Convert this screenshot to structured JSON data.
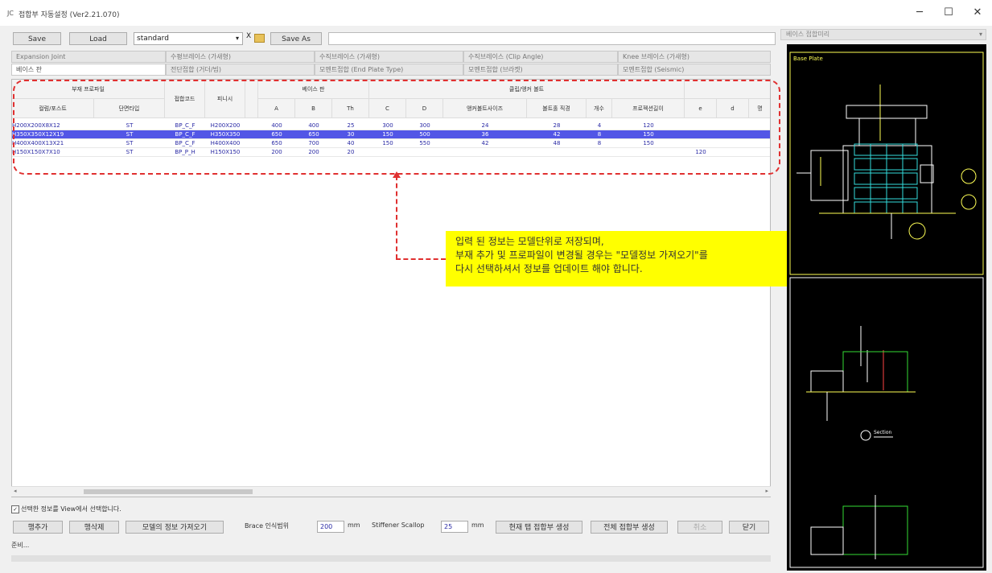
{
  "window": {
    "title": "접합부 자동설정 (Ver2.21.070)",
    "app_icon": "JC",
    "minimize": "─",
    "maximize": "☐",
    "close": "✕"
  },
  "toolbar": {
    "save": "Save",
    "load": "Load",
    "preset": "standard",
    "preset_arrow": "▾",
    "clear": "X",
    "save_as": "Save As",
    "path": ""
  },
  "tabs": [
    "Expansion Joint",
    "수평브레이스 (가새형)",
    "수직브레이스 (가새형)",
    "수직브레이스 (Clip Angle)",
    "Knee 브레이스 (가새형)",
    "베이스 판",
    "전단접합 (거더/빔)",
    "모멘트접합 (End Plate Type)",
    "모멘트접합 (브라켓)",
    "모멘트접합 (Seismic)"
  ],
  "grid": {
    "group_headers": [
      "부재 프로파일",
      "베이스 판",
      "클립/앵커 볼트"
    ],
    "headers": [
      "컬럼/포스트",
      "단면타입",
      "접합코드",
      "피니시",
      "A",
      "B",
      "Th",
      "C",
      "D",
      "앵커볼트사이즈",
      "볼트홀 직경",
      "개수",
      "프로젝션길이",
      "e",
      "d",
      "명"
    ],
    "rows": [
      [
        "H200X200X8X12",
        "ST",
        "BP_C_F",
        "H200X200",
        "400",
        "400",
        "25",
        "300",
        "300",
        "24",
        "28",
        "4",
        "120",
        "",
        "",
        ""
      ],
      [
        "H350X350X12X19",
        "ST",
        "BP_C_F",
        "H350X350",
        "650",
        "650",
        "30",
        "150",
        "500",
        "36",
        "42",
        "8",
        "150",
        "",
        "",
        ""
      ],
      [
        "H400X400X13X21",
        "ST",
        "BP_C_F",
        "H400X400",
        "650",
        "700",
        "40",
        "150",
        "550",
        "42",
        "48",
        "8",
        "150",
        "",
        "",
        ""
      ],
      [
        "H150X150X7X10",
        "ST",
        "BP_P_H",
        "H150X150",
        "200",
        "200",
        "20",
        "",
        "",
        "",
        "",
        "",
        "",
        "120",
        "",
        ""
      ]
    ],
    "selected_row": 1
  },
  "callout": {
    "line1": "입력 된 정보는 모델단위로 저장되며,",
    "line2": "부재 추가 및 프로파일이 변경될 경우는 \"모델정보 가져오기\"를",
    "line3": "다시 선택하셔서 정보를 업데이트 해야 합니다."
  },
  "check_label": "선택한 정보를 View에서 선택합니다.",
  "bottom": {
    "add_row": "행추가",
    "delete_row": "행삭제",
    "import_model": "모델의 정보 가져오기",
    "brace_label": "Brace 인식범위",
    "brace_value": "200",
    "brace_unit": "mm",
    "stiff_label": "Stiffener Scallop",
    "stiff_value": "25",
    "stiff_unit": "mm",
    "create_current": "현재 탭 접합부 생성",
    "create_all": "전체 접합부 생성",
    "cancel": "취소",
    "close": "닫기"
  },
  "status": "준비...",
  "preview": {
    "panel_title": "베이스 접합미리",
    "drawing_title": "Base Plate",
    "section_label": "Section"
  },
  "colors": {
    "selection": "#5256e6",
    "callout": "#ffff00",
    "frame": "#e03030",
    "cad_bg": "#000000"
  }
}
